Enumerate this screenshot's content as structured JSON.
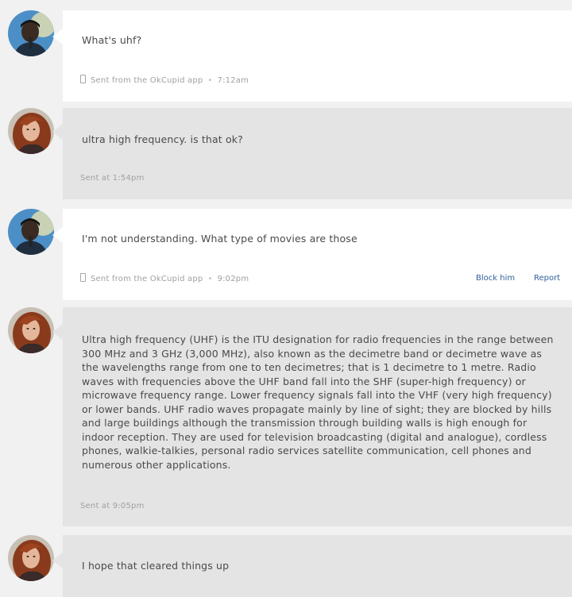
{
  "messages": [
    {
      "sender": "him",
      "text": "What's uhf?",
      "meta_prefix": "Sent from the OkCupid app",
      "meta_dot": "•",
      "time": "7:12am"
    },
    {
      "sender": "her",
      "text": "ultra high frequency. is that ok?",
      "meta": "Sent at 1:54pm"
    },
    {
      "sender": "him",
      "text": "I'm not understanding. What type of movies are those",
      "meta_prefix": "Sent from the OkCupid app",
      "meta_dot": "•",
      "time": "9:02pm",
      "block_label": "Block him",
      "report_label": "Report"
    },
    {
      "sender": "her",
      "text": "Ultra high frequency (UHF) is the ITU designation for radio frequencies in the range between 300 MHz and 3 GHz (3,000 MHz), also known as the decimetre band or decimetre wave as the wavelengths range from one to ten decimetres; that is 1 decimetre to 1 metre. Radio waves with frequencies above the UHF band fall into the SHF (super-high frequency) or microwave frequency range. Lower frequency signals fall into the VHF (very high frequency) or lower bands. UHF radio waves propagate mainly by line of sight; they are blocked by hills and large buildings although the transmission through building walls is high enough for indoor reception. They are used for television broadcasting (digital and analogue), cordless phones, walkie-talkies, personal radio services satellite communication, cell phones and numerous other applications.",
      "meta": "Sent at 9:05pm"
    },
    {
      "sender": "her",
      "text": "I hope that cleared things up"
    }
  ],
  "colors": {
    "page_bg": "#f1f1f1",
    "sent_bubble": "#ffffff",
    "received_bubble": "#e4e4e4",
    "link": "#2f5f9a"
  }
}
